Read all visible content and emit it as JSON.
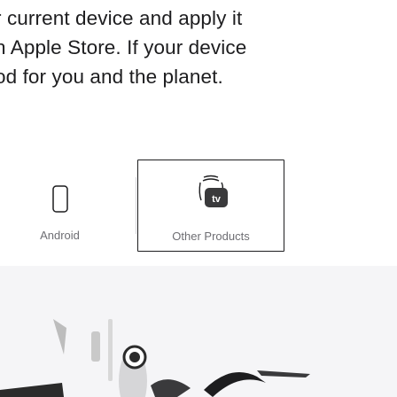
{
  "intro": {
    "line1": "r current device and apply it",
    "line2": "n Apple Store. If your device",
    "line3": "od for you and the planet."
  },
  "tiles": {
    "android": {
      "label": "Android",
      "icon": "android-phone-icon"
    },
    "other": {
      "label": "Other Products",
      "icon": "watch-appletv-icon",
      "badge": "tv"
    }
  },
  "colors": {
    "text": "#1d1d1f",
    "label": "#6e6e73",
    "hero_bg": "#f5f5f7",
    "selected_border": "#1d1d1f"
  }
}
